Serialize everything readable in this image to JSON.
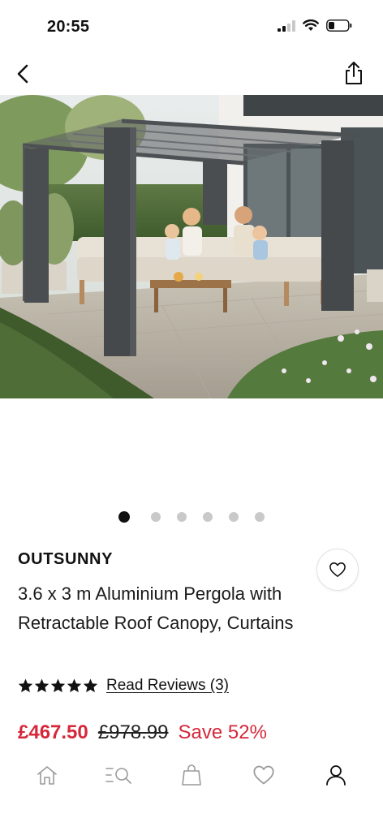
{
  "status_bar": {
    "time": "20:55",
    "icons": [
      "cellular-signal-icon",
      "wifi-icon",
      "battery-icon"
    ]
  },
  "nav": {
    "back_icon": "chevron-left-icon",
    "share_icon": "share-icon"
  },
  "gallery": {
    "image_count": 6,
    "active_index": 0
  },
  "product": {
    "brand": "OUTSUNNY",
    "title": "3.6 x 3 m Aluminium Pergola with Retractable Roof Canopy, Curtains",
    "rating_stars": 5,
    "reviews_label": "Read Reviews (3)",
    "price_now": "£467.50",
    "price_was": "£978.99",
    "save_label": "Save 52%"
  },
  "colors": {
    "sale_red": "#d5283a",
    "text": "#111111"
  },
  "tab_bar": {
    "items": [
      "home-icon",
      "search-menu-icon",
      "bag-icon",
      "heart-icon",
      "account-icon"
    ]
  }
}
